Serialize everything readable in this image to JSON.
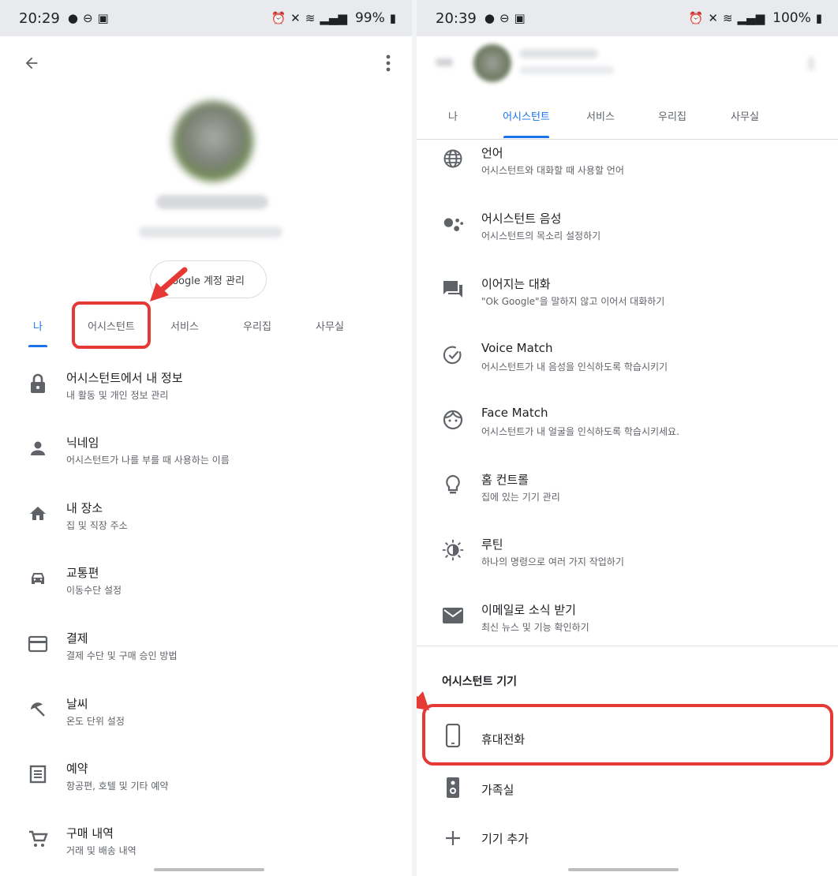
{
  "left": {
    "status": {
      "time": "20:29",
      "battery": "99%"
    },
    "manage_button": "oogle 계정 관리",
    "tabs": [
      "나",
      "어시스턴트",
      "서비스",
      "우리집",
      "사무실"
    ],
    "items": [
      {
        "title": "어시스턴트에서 내 정보",
        "subtitle": "내 활동 및 개인 정보 관리",
        "icon": "lock-icon"
      },
      {
        "title": "닉네임",
        "subtitle": "어시스턴트가 나를 부를 때 사용하는 이름",
        "icon": "person-icon"
      },
      {
        "title": "내 장소",
        "subtitle": "집 및 직장 주소",
        "icon": "home-icon"
      },
      {
        "title": "교통편",
        "subtitle": "이동수단 설정",
        "icon": "car-icon"
      },
      {
        "title": "결제",
        "subtitle": "결제 수단 및 구매 승인 방법",
        "icon": "credit-card-icon"
      },
      {
        "title": "날씨",
        "subtitle": "온도 단위 설정",
        "icon": "umbrella-icon"
      },
      {
        "title": "예약",
        "subtitle": "항공편, 호텔 및 기타 예약",
        "icon": "list-doc-icon"
      },
      {
        "title": "구매 내역",
        "subtitle": "거래 및 배송 내역",
        "icon": "cart-icon"
      }
    ]
  },
  "right": {
    "status": {
      "time": "20:39",
      "battery": "100%"
    },
    "tabs": [
      "나",
      "어시스턴트",
      "서비스",
      "우리집",
      "사무실"
    ],
    "items": [
      {
        "title": "언어",
        "subtitle": "어시스턴트와 대화할 때 사용할 언어",
        "icon": "globe-icon"
      },
      {
        "title": "어시스턴트 음성",
        "subtitle": "어시스턴트의 목소리 설정하기",
        "icon": "assistant-dots-icon"
      },
      {
        "title": "이어지는 대화",
        "subtitle": "\"Ok Google\"을 말하지 않고 이어서 대화하기",
        "icon": "chat-icon"
      },
      {
        "title": "Voice Match",
        "subtitle": "어시스턴트가 내 음성을 인식하도록 학습시키기",
        "icon": "voice-match-icon"
      },
      {
        "title": "Face Match",
        "subtitle": "어시스턴트가 내 얼굴을 인식하도록 학습시키세요.",
        "icon": "face-icon"
      },
      {
        "title": "홈 컨트롤",
        "subtitle": "집에 있는 기기 관리",
        "icon": "lightbulb-icon"
      },
      {
        "title": "루틴",
        "subtitle": "하나의 명령으로 여러 가지 작업하기",
        "icon": "routine-icon"
      },
      {
        "title": "이메일로 소식 받기",
        "subtitle": "최신 뉴스 및 기능 확인하기",
        "icon": "mail-icon"
      }
    ],
    "devices_section_title": "어시스턴트 기기",
    "devices": [
      {
        "title": "휴대전화",
        "icon": "phone-icon"
      },
      {
        "title": "가족실",
        "icon": "speaker-icon"
      },
      {
        "title": "기기 추가",
        "icon": "plus-icon"
      }
    ]
  },
  "colors": {
    "accent": "#1a73e8",
    "highlight": "#e53935"
  }
}
